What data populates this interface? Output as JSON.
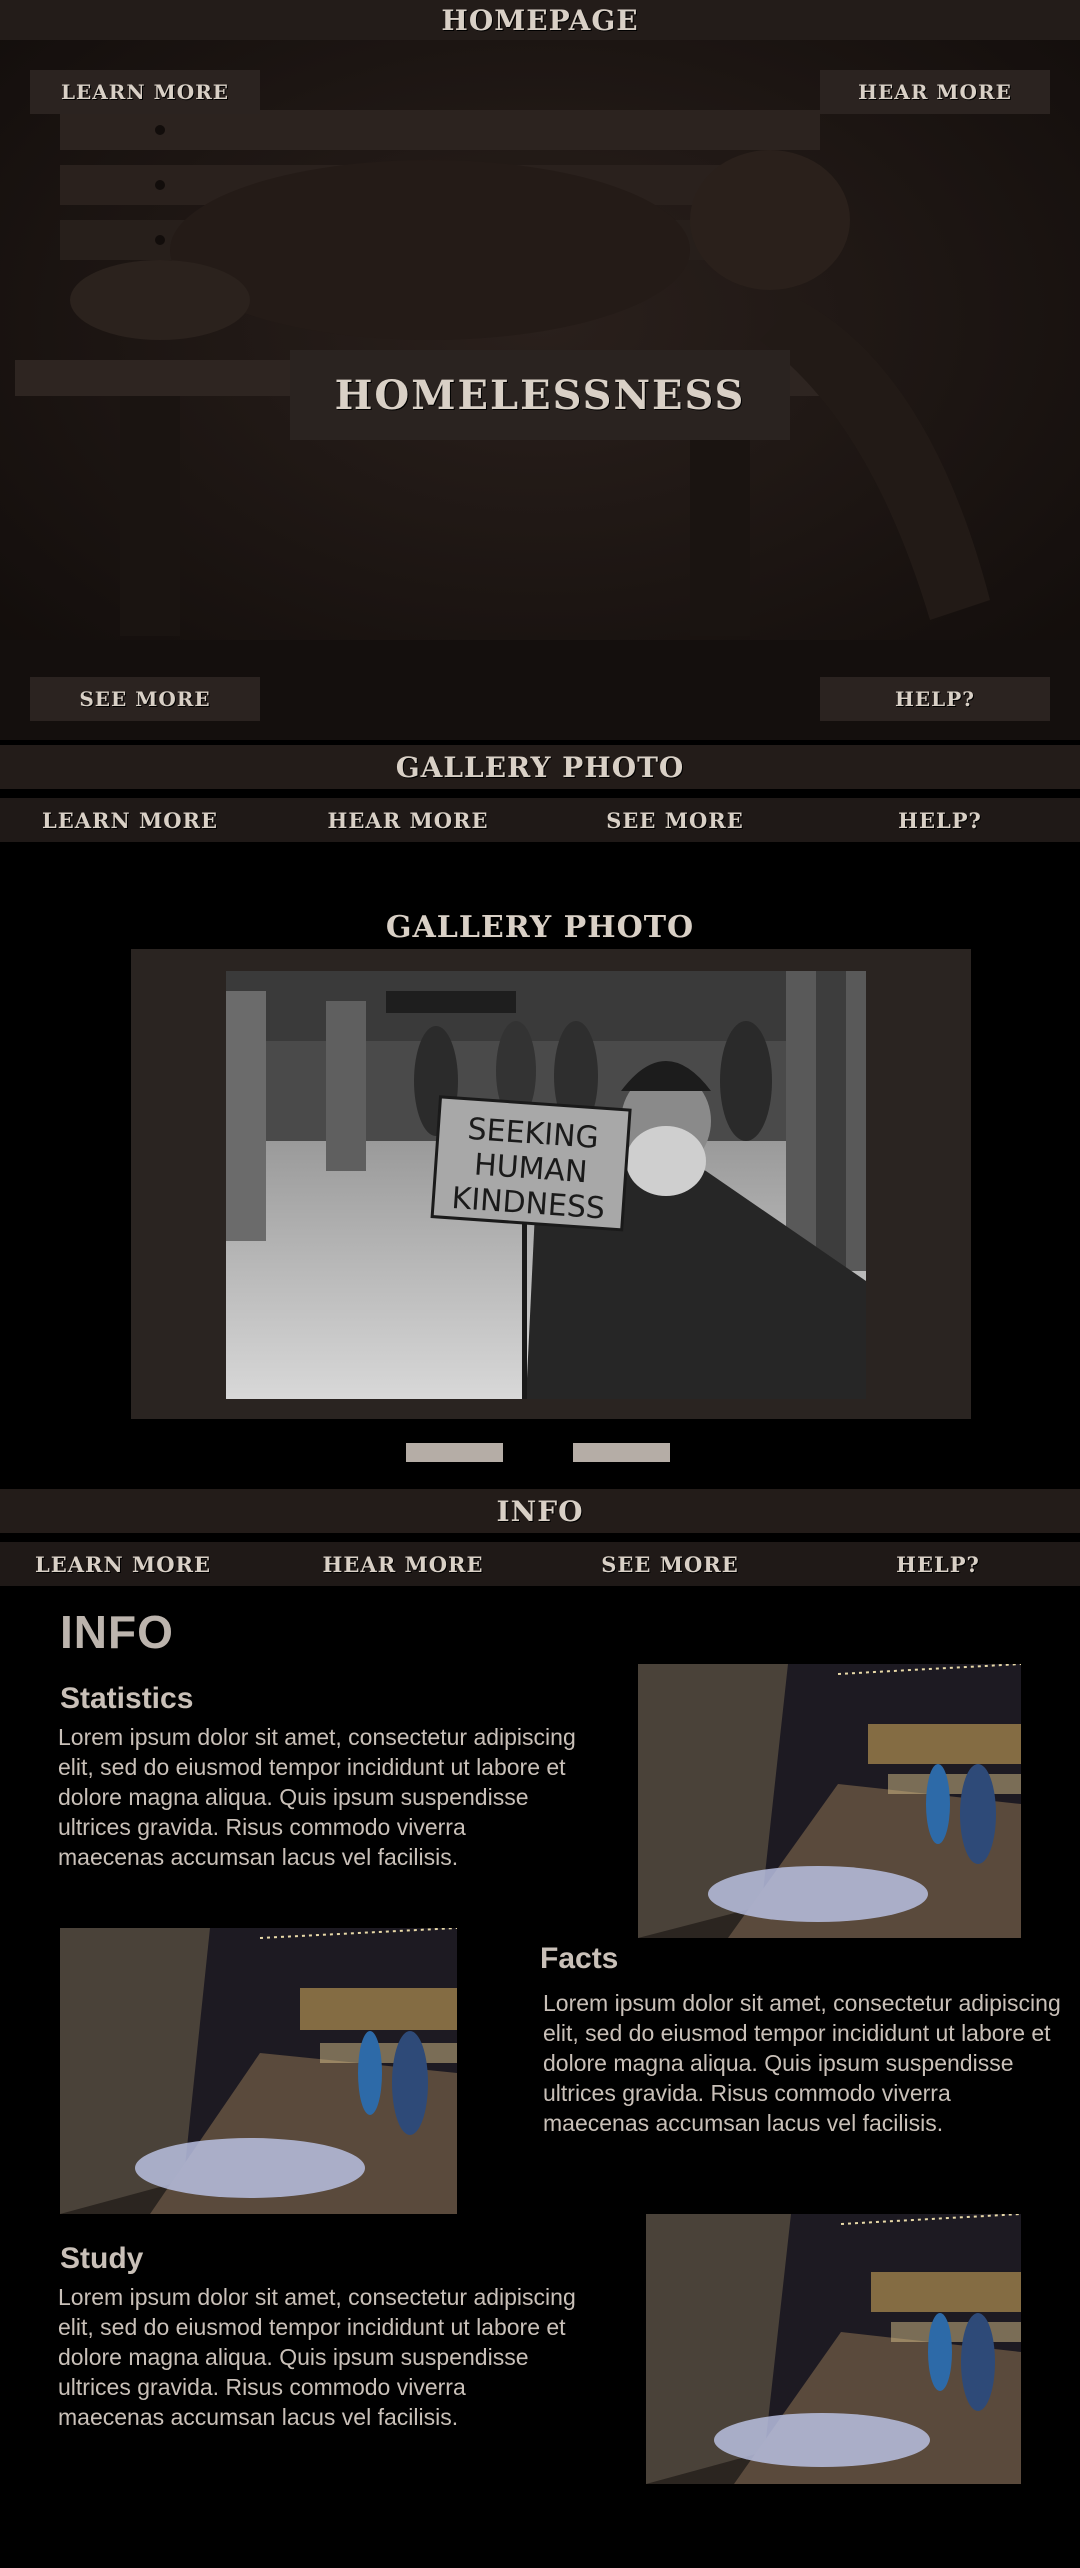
{
  "homepage_bar": {
    "title": "HOMEPAGE"
  },
  "hero": {
    "title": "HOMELESSNESS",
    "btn_top_left": "LEARN MORE",
    "btn_top_right": "HEAR MORE",
    "btn_bottom_left": "SEE MORE",
    "btn_bottom_right": "HELP?"
  },
  "gallery_bar": {
    "title": "GALLERY PHOTO"
  },
  "nav": {
    "learn": "LEARN MORE",
    "hear": "HEAR MORE",
    "see": "SEE MORE",
    "help": "HELP?"
  },
  "gallery": {
    "heading": "GALLERY PHOTO",
    "sign_line1": "SEEKING",
    "sign_line2": "HUMAN",
    "sign_line3": "KINDNESS"
  },
  "info_bar": {
    "title": "INFO"
  },
  "info": {
    "title": "INFO",
    "sections": [
      {
        "heading": "Statistics",
        "body": "Lorem ipsum dolor sit amet, consectetur adipiscing elit, sed do eiusmod tempor incididunt ut labore et dolore magna aliqua. Quis ipsum suspendisse ultrices gravida. Risus commodo viverra maecenas accumsan lacus vel facilisis."
      },
      {
        "heading": "Facts",
        "body": "Lorem ipsum dolor sit amet, consectetur adipiscing elit, sed do eiusmod tempor incididunt ut labore et dolore magna aliqua. Quis ipsum suspendisse ultrices gravida. Risus commodo viverra maecenas accumsan lacus vel facilisis."
      },
      {
        "heading": "Study",
        "body": "Lorem ipsum dolor sit amet, consectetur adipiscing elit, sed do eiusmod tempor incididunt ut labore et dolore magna aliqua. Quis ipsum suspendisse ultrices gravida. Risus commodo viverra maecenas accumsan lacus vel facilisis."
      }
    ]
  },
  "colors": {
    "bar_bg": "#231c19",
    "nav_bg": "#1f1917",
    "button_bg": "#2b2320",
    "text_light": "#d9d0c6",
    "page_bg": "#000000"
  }
}
